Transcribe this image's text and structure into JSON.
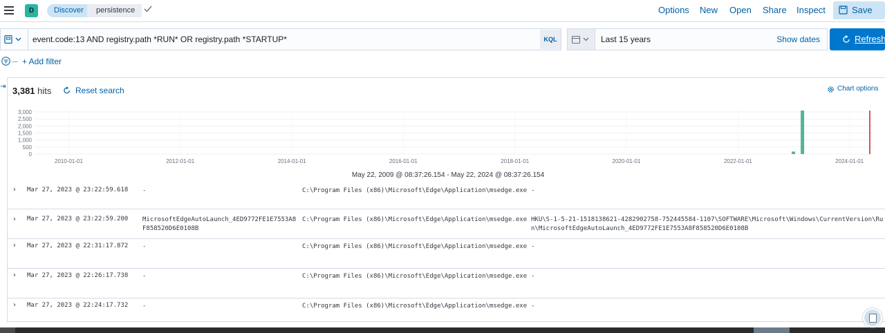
{
  "topbar": {
    "app_badge": "D",
    "breadcrumbs": [
      "Discover",
      "persistence"
    ],
    "nav": [
      "Options",
      "New",
      "Open",
      "Share",
      "Inspect"
    ],
    "save_label": "Save"
  },
  "query": {
    "text": "event.code:13 AND registry.path *RUN* OR registry.path *STARTUP*",
    "language": "KQL"
  },
  "date": {
    "range": "Last 15 years",
    "show_dates": "Show dates",
    "refresh_label": "Refresh"
  },
  "filters": {
    "add_filter": "+ Add filter"
  },
  "results": {
    "hits_count": "3,381",
    "hits_label": "hits",
    "reset_search": "Reset search",
    "chart_options": "Chart options",
    "time_range_text": "May 22, 2009 @ 08:37:26.154 - May 22, 2024 @ 08:37:26.154"
  },
  "chart_data": {
    "type": "bar",
    "y_ticks": [
      "3,000",
      "2,500",
      "2,000",
      "1,500",
      "1,000",
      "500",
      "0"
    ],
    "x_ticks": [
      "2010-01-01",
      "2012-01-01",
      "2014-01-01",
      "2016-01-01",
      "2018-01-01",
      "2020-01-01",
      "2022-01-01",
      "2024-01-01"
    ],
    "ylim": [
      0,
      3100
    ],
    "series": [
      {
        "x": "2023-01-01",
        "value": 180
      },
      {
        "x": "2023-03-01",
        "value": 3200
      }
    ],
    "colors": {
      "bar": "#54b399",
      "now_marker": "#bd271e",
      "grid": "#eef0f4"
    }
  },
  "documents": [
    {
      "timestamp": "Mar 27, 2023 @ 23:22:59.618",
      "col1": "-",
      "col2": "C:\\Program Files (x86)\\Microsoft\\Edge\\Application\\msedge.exe",
      "col3": "-"
    },
    {
      "timestamp": "Mar 27, 2023 @ 23:22:59.200",
      "col1": "MicrosoftEdgeAutoLaunch_4ED9772FE1E7553A8F858520D6E0108B",
      "col2": "C:\\Program Files (x86)\\Microsoft\\Edge\\Application\\msedge.exe",
      "col3": "HKU\\S-1-5-21-1518138621-4282902758-752445584-1107\\SOFTWARE\\Microsoft\\Windows\\CurrentVersion\\Run\\MicrosoftEdgeAutoLaunch_4ED9772FE1E7553A8F858520D6E0108B"
    },
    {
      "timestamp": "Mar 27, 2023 @ 22:31:17.872",
      "col1": "-",
      "col2": "C:\\Program Files (x86)\\Microsoft\\Edge\\Application\\msedge.exe",
      "col3": "-"
    },
    {
      "timestamp": "Mar 27, 2023 @ 22:26:17.738",
      "col1": "-",
      "col2": "C:\\Program Files (x86)\\Microsoft\\Edge\\Application\\msedge.exe",
      "col3": "-"
    },
    {
      "timestamp": "Mar 27, 2023 @ 22:24:17.732",
      "col1": "-",
      "col2": "C:\\Program Files (x86)\\Microsoft\\Edge\\Application\\msedge.exe",
      "col3": "-"
    }
  ]
}
